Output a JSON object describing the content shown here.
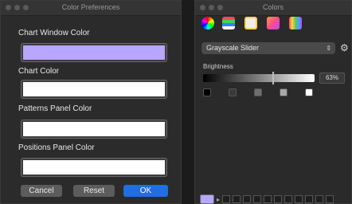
{
  "prefs": {
    "title": "Color Preferences",
    "fields": [
      {
        "label": "Chart Window Color",
        "color": "#b8a6ff"
      },
      {
        "label": "Chart Color",
        "color": "#ffffff"
      },
      {
        "label": "Patterns Panel Color",
        "color": "#ffffff"
      },
      {
        "label": "Positions Panel Color",
        "color": "#ffffff"
      }
    ],
    "buttons": {
      "cancel": "Cancel",
      "reset": "Reset",
      "ok": "OK"
    }
  },
  "colors": {
    "title": "Colors",
    "toolbar": [
      "color-wheel-icon",
      "color-sliders-icon",
      "color-palettes-icon",
      "image-palettes-icon",
      "pencils-icon"
    ],
    "mode": "Grayscale Slider",
    "brightness_label": "Brightness",
    "brightness_value": "63%",
    "brightness_fraction": 0.63,
    "presets": [
      "#000000",
      "#3a3a3a",
      "#6e6e6e",
      "#a8a8a8",
      "#ffffff"
    ],
    "current_color": "#b8a6ff"
  }
}
